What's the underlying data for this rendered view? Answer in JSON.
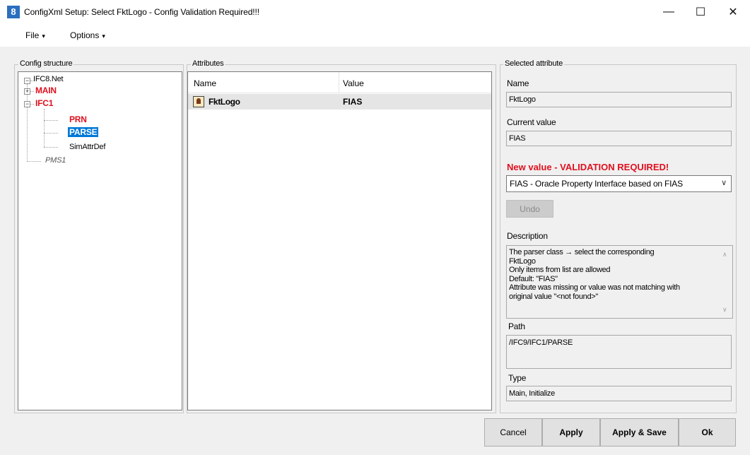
{
  "window": {
    "title": "ConfigXml Setup: Select FktLogo - Config Validation Required!!!",
    "app_icon_text": "8",
    "minimize_glyph": "—",
    "maximize_glyph": "☐",
    "close_glyph": "✕"
  },
  "menu": {
    "file_label": "File",
    "options_label": "Options",
    "caret": "▾"
  },
  "config_structure": {
    "label": "Config structure",
    "root": "IFC8.Net",
    "nodes": {
      "main": "MAIN",
      "ifc1": "IFC1",
      "prn": "PRN",
      "parse": "PARSE",
      "simattrdef": "SimAttrDef",
      "pms1": "PMS1"
    },
    "expand_glyph": "+",
    "collapse_glyph": "−"
  },
  "attributes": {
    "label": "Attributes",
    "columns": [
      "Name",
      "Value"
    ],
    "rows": [
      {
        "name": "FktLogo",
        "value": "FIAS",
        "icon": "attribute-icon"
      }
    ]
  },
  "selected_attribute": {
    "label": "Selected attribute",
    "name_label": "Name",
    "name_value": "FktLogo",
    "current_value_label": "Current value",
    "current_value": "FIAS",
    "new_value_label": "New value - VALIDATION REQUIRED!",
    "new_value_selected": "FIAS - Oracle Property Interface based on FIAS",
    "undo_label": "Undo",
    "description_label": "Description",
    "description_lines": [
      "The parser class → select the corresponding",
      "FktLogo",
      "Only items from list are allowed",
      "Default: \"FIAS\"",
      "Attribute was missing or value was not matching with",
      "original value \"<not found>\""
    ],
    "path_label": "Path",
    "path_value": "/IFC9/IFC1/PARSE",
    "type_label": "Type",
    "type_value": "Main, Initialize"
  },
  "buttons": {
    "cancel": "Cancel",
    "apply": "Apply",
    "apply_save": "Apply & Save",
    "ok": "Ok"
  },
  "colors": {
    "required_red": "#e0101e",
    "selection_blue": "#0078d7"
  }
}
